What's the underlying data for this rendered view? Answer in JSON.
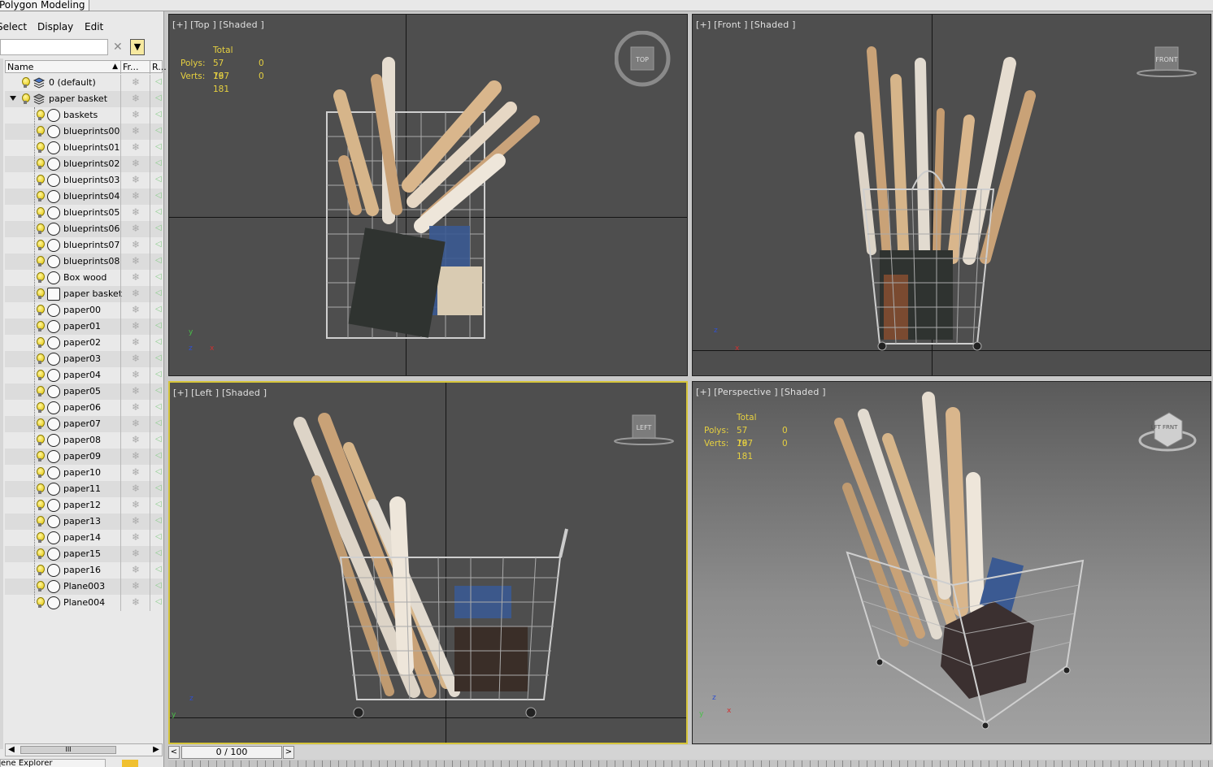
{
  "ribbon": {
    "tab_label": "Polygon Modeling"
  },
  "explorer": {
    "menu": [
      "Select",
      "Display",
      "Edit"
    ],
    "search_placeholder": "",
    "columns": {
      "name": "Name",
      "frozen": "Fr...",
      "render": "R..."
    },
    "layers": [
      {
        "label": "0 (default)",
        "type": "layer"
      },
      {
        "label": "paper basket",
        "type": "layer",
        "expanded": true
      }
    ],
    "objects": [
      "baskets",
      "blueprints00",
      "blueprints01",
      "blueprints02",
      "blueprints03",
      "blueprints04",
      "blueprints05",
      "blueprints06",
      "blueprints07",
      "blueprints08",
      "Box wood",
      "paper basket",
      "paper00",
      "paper01",
      "paper02",
      "paper03",
      "paper04",
      "paper05",
      "paper06",
      "paper07",
      "paper08",
      "paper09",
      "paper10",
      "paper11",
      "paper12",
      "paper13",
      "paper14",
      "paper15",
      "paper16",
      "Plane003",
      "Plane004"
    ],
    "hscroll_thumb": "III",
    "footer_label": "ene Explorer"
  },
  "viewports": {
    "top": {
      "label": "[+] [Top ] [Shaded ]",
      "cube": "TOP"
    },
    "front": {
      "label": "[+] [Front ] [Shaded ]",
      "cube": "FRONT"
    },
    "left": {
      "label": "[+] [Left ] [Shaded ]",
      "cube": "LEFT"
    },
    "perspective": {
      "label": "[+] [Perspective ] [Shaded ]",
      "cube": "LFT FRNT"
    }
  },
  "stats": {
    "total": "Total",
    "polys_label": "Polys:",
    "verts_label": "Verts:",
    "polys": "57 167",
    "verts": "79 181",
    "sel_polys": "0",
    "sel_verts": "0"
  },
  "time": {
    "position": "0 / 100",
    "prev": "<",
    "next": ">"
  },
  "colors": {
    "viewport_bg": "#4e4e4e",
    "active_border": "#d6c53a",
    "stats_text": "#e6d040"
  }
}
